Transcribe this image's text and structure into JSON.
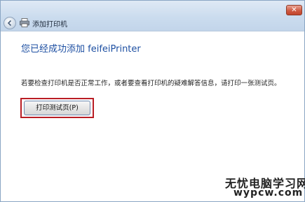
{
  "titlebar": {
    "title": "添加打印机",
    "close_label": "✕",
    "back_icon": "back-arrow-icon",
    "printer_icon": "printer-icon"
  },
  "main": {
    "heading": "您已经成功添加 feifeiPrinter",
    "info": "若要检查打印机是否正常工作，或者要查看打印机的疑难解答信息，请打印一张测试页。",
    "test_button_label": "打印测试页(P)"
  },
  "watermark": {
    "line1": "无忧电脑学习网",
    "line2": "wypcw.com"
  },
  "colors": {
    "heading": "#1d4fa2",
    "highlight": "#b91d24"
  }
}
